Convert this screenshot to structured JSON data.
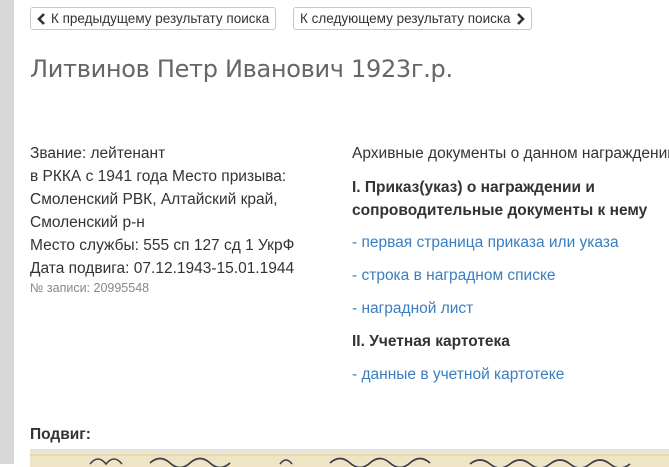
{
  "nav": {
    "prev_label": "К предыдущему результату поиска",
    "next_label": "К следующему результату поиска"
  },
  "person": {
    "title": "Литвинов Петр Иванович 1923г.р."
  },
  "info": {
    "rank": "Звание: лейтенант",
    "conscription_lines": [
      "в РККА с 1941 года Место призыва:",
      "Смоленский РВК, Алтайский край,",
      "Смоленский р-н"
    ],
    "service_place": "Место службы: 555 сп 127 сд 1 УкрФ",
    "feat_date": "Дата подвига: 07.12.1943-15.01.1944",
    "record_number": "№ записи: 20995548"
  },
  "archive": {
    "header": "Архивные документы о данном награждении",
    "section1_title": "I. Приказ(указ) о награждении и сопроводительные документы к нему",
    "section1_links": [
      "- первая страница приказа или указа",
      "- строка в наградном списке",
      "- наградной лист"
    ],
    "section2_title": "II. Учетная картотека",
    "section2_links": [
      "- данные в учетной картотеке"
    ]
  },
  "feat": {
    "label": "Подвиг:",
    "handwriting_text": "Литвинов ... лейтенант ..."
  },
  "colors": {
    "link": "#3a7ebf",
    "title": "#666666",
    "text": "#333333",
    "muted": "#888888",
    "paper": "#efe4c3"
  },
  "icons": {
    "prev": "chevron-left-icon",
    "next": "chevron-right-icon"
  }
}
